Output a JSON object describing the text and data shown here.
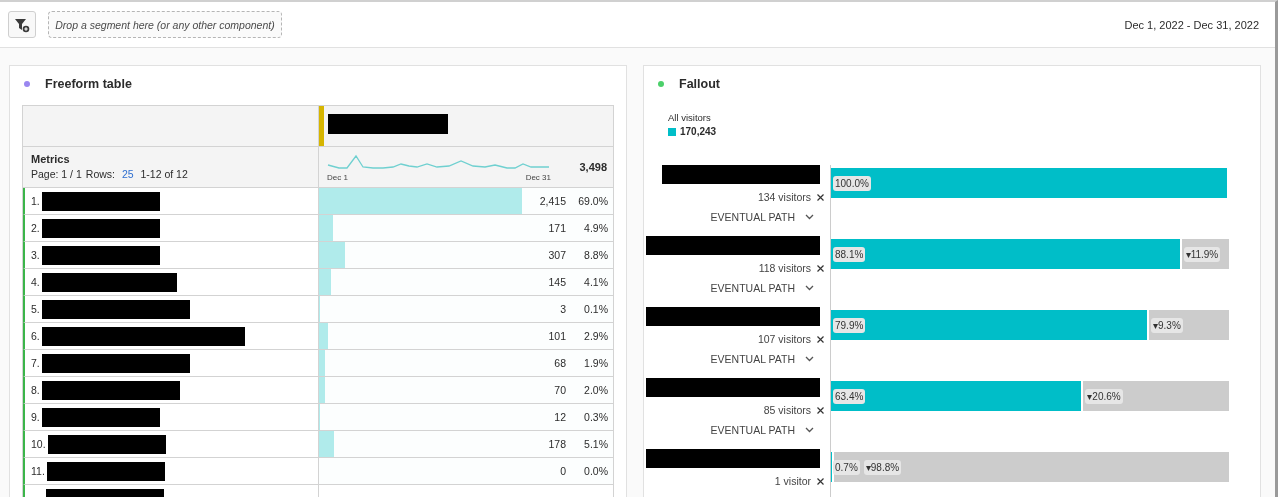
{
  "toolbar": {
    "drop_zone": {
      "placeholder": "Drop a segment here (or any other component)"
    },
    "date_range": "Dec 1, 2022 - Dec 31, 2022"
  },
  "freeform_table": {
    "title": "Freeform table",
    "color": "#9a87f0",
    "metrics_label": "Metrics",
    "paging": {
      "page": "Page: 1 / 1",
      "rows_label": "Rows:",
      "rows": "25",
      "range": "1-12 of 12"
    },
    "spark_start": "Dec 1",
    "spark_end": "Dec 31",
    "total": "3,498",
    "rows": [
      {
        "index": "1.",
        "value": "2,415",
        "percent": "69.0%",
        "level": 0.69
      },
      {
        "index": "2.",
        "value": "171",
        "percent": "4.9%",
        "level": 0.049
      },
      {
        "index": "3.",
        "value": "307",
        "percent": "8.8%",
        "level": 0.088
      },
      {
        "index": "4.",
        "value": "145",
        "percent": "4.1%",
        "level": 0.041
      },
      {
        "index": "5.",
        "value": "3",
        "percent": "0.1%",
        "level": 0.001
      },
      {
        "index": "6.",
        "value": "101",
        "percent": "2.9%",
        "level": 0.029
      },
      {
        "index": "7.",
        "value": "68",
        "percent": "1.9%",
        "level": 0.019
      },
      {
        "index": "8.",
        "value": "70",
        "percent": "2.0%",
        "level": 0.02
      },
      {
        "index": "9.",
        "value": "12",
        "percent": "0.3%",
        "level": 0.003
      },
      {
        "index": "10.",
        "value": "178",
        "percent": "5.1%",
        "level": 0.051
      },
      {
        "index": "11.",
        "value": "0",
        "percent": "0.0%",
        "level": 0
      }
    ]
  },
  "fallout": {
    "title": "Fallout",
    "color": "#4cd06a",
    "legend_label": "All visitors",
    "legend_value": "170,243",
    "steps": [
      {
        "visitors": "134 visitors",
        "level": 1.0,
        "percent": "100.0%",
        "path": "EVENTUAL PATH"
      },
      {
        "visitors": "118 visitors",
        "level": 0.881,
        "percent": "88.1%",
        "drop": "▾11.9%",
        "path": "EVENTUAL PATH"
      },
      {
        "visitors": "107 visitors",
        "level": 0.799,
        "percent": "79.9%",
        "drop": "▾9.3%",
        "path": "EVENTUAL PATH"
      },
      {
        "visitors": "85 visitors",
        "level": 0.634,
        "percent": "63.4%",
        "drop": "▾20.6%",
        "path": "EVENTUAL PATH"
      },
      {
        "visitors": "1 visitor",
        "level": 0.007,
        "percent": "0.7%",
        "drop": "▾98.8%"
      }
    ]
  }
}
